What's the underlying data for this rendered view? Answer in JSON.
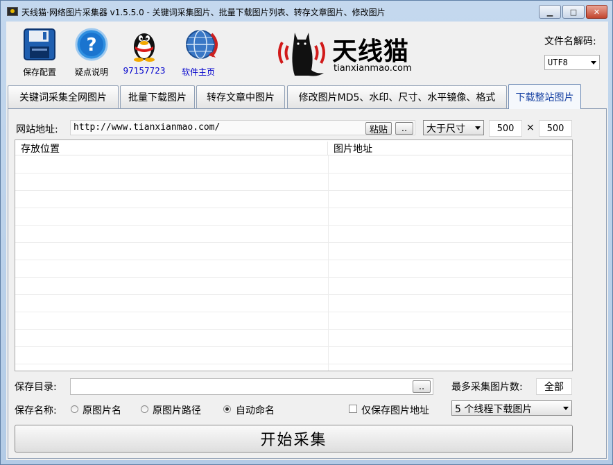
{
  "window": {
    "title": "天线猫·网络图片采集器 v1.5.5.0 - 关键词采集图片、批量下载图片列表、转存文章图片、修改图片"
  },
  "toolbar": {
    "save_label": "保存配置",
    "help_label": "疑点说明",
    "qq_label": "97157723",
    "home_label": "软件主页"
  },
  "logo": {
    "name": "天线猫",
    "domain": "tianxianmao.com"
  },
  "filename_decode": {
    "label": "文件名解码:",
    "value": "UTF8"
  },
  "tabs": [
    {
      "label": "关键词采集全网图片"
    },
    {
      "label": "批量下载图片"
    },
    {
      "label": "转存文章中图片"
    },
    {
      "label": "修改图片MD5、水印、尺寸、水平镜像、格式"
    },
    {
      "label": "下载整站图片",
      "active": true
    }
  ],
  "site": {
    "label": "网站地址:",
    "url": "http://www.tianxianmao.com/",
    "paste_label": "粘贴",
    "browse_label": "..",
    "size_filter": "大于尺寸",
    "width": "500",
    "times": "×",
    "height": "500"
  },
  "table": {
    "columns": [
      "存放位置",
      "图片地址"
    ]
  },
  "save_dir": {
    "label": "保存目录:",
    "browse_label": "..",
    "max_label": "最多采集图片数:",
    "max_value": "全部"
  },
  "save_name": {
    "label": "保存名称:",
    "options": [
      "原图片名",
      "原图片路径",
      "自动命名"
    ],
    "selected": "自动命名",
    "only_url_label": "仅保存图片地址",
    "threads": "5 个线程下载图片"
  },
  "start_label": "开始采集",
  "colors": {
    "logo_red": "#d11a1a",
    "active_tab_text": "#1a44a4",
    "qq_text": "#0000cc"
  }
}
